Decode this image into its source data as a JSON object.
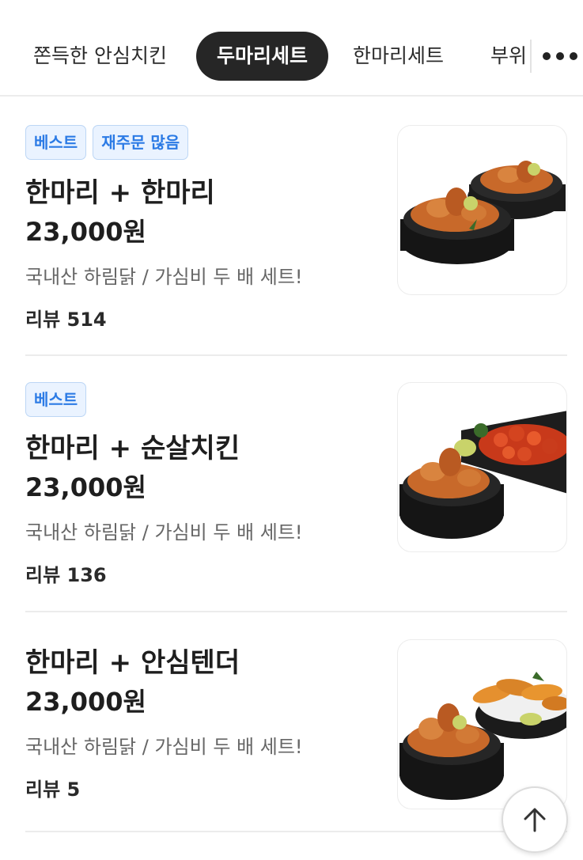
{
  "tabs": [
    {
      "label": "쫀득한 안심치킨",
      "active": false
    },
    {
      "label": "두마리세트",
      "active": true
    },
    {
      "label": "한마리세트",
      "active": false
    },
    {
      "label": "부위",
      "active": false
    }
  ],
  "items": [
    {
      "badges": [
        "베스트",
        "재주문 많음"
      ],
      "name": "한마리 + 한마리",
      "price": "23,000원",
      "desc": "국내산 하림닭  /  가심비 두 배 세트!",
      "review": "리뷰 514",
      "image": "two-chicken-bowls"
    },
    {
      "badges": [
        "베스트"
      ],
      "name": "한마리 + 순살치킨",
      "price": "23,000원",
      "desc": "국내산 하림닭  /  가심비 두 배 세트!",
      "review": "리뷰 136",
      "image": "chicken-and-spicy-boneless"
    },
    {
      "badges": [],
      "name": "한마리 + 안심텐더",
      "price": "23,000원",
      "desc": "국내산 하림닭  /  가심비 두 배 세트!",
      "review": "리뷰 5",
      "image": "chicken-and-tenders"
    }
  ],
  "colors": {
    "accent_badge_text": "#2c7be5",
    "accent_badge_bg": "#eaf3ff",
    "active_tab_bg": "#262626"
  },
  "icons": {
    "more": "more-dots-icon",
    "scroll_top": "arrow-up-icon"
  }
}
